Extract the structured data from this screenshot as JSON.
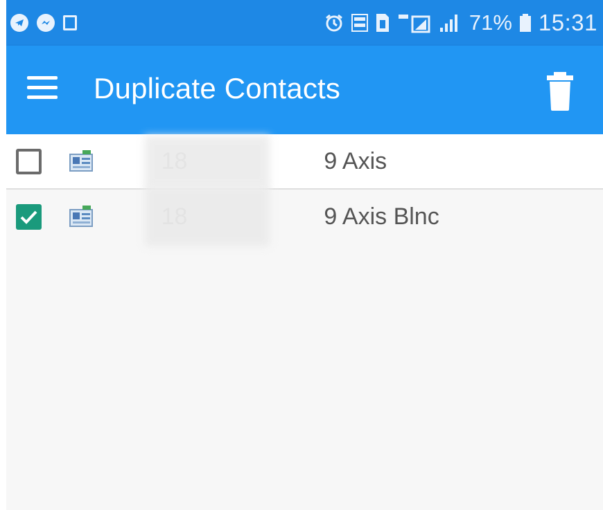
{
  "status_bar": {
    "battery_percent": "71%",
    "time": "15:31",
    "left_icons": [
      "telegram-icon",
      "messenger-icon",
      "image-icon"
    ],
    "right_icons": [
      "alarm-icon",
      "volte-icon",
      "sim-icon",
      "lte-icon",
      "signal-icon",
      "battery-icon"
    ]
  },
  "app_bar": {
    "title": "Duplicate Contacts",
    "menu_icon": "hamburger-menu-icon",
    "action_icon": "trash-icon"
  },
  "contacts": [
    {
      "prefix": "18",
      "suffix": "9 Axis",
      "checked": false
    },
    {
      "prefix": "18",
      "suffix": "9 Axis Blnc",
      "checked": true
    }
  ],
  "colors": {
    "status_bar": "#1e88e5",
    "app_bar": "#2196f3",
    "checkbox_checked": "#1a9a7c",
    "text": "#555555"
  }
}
